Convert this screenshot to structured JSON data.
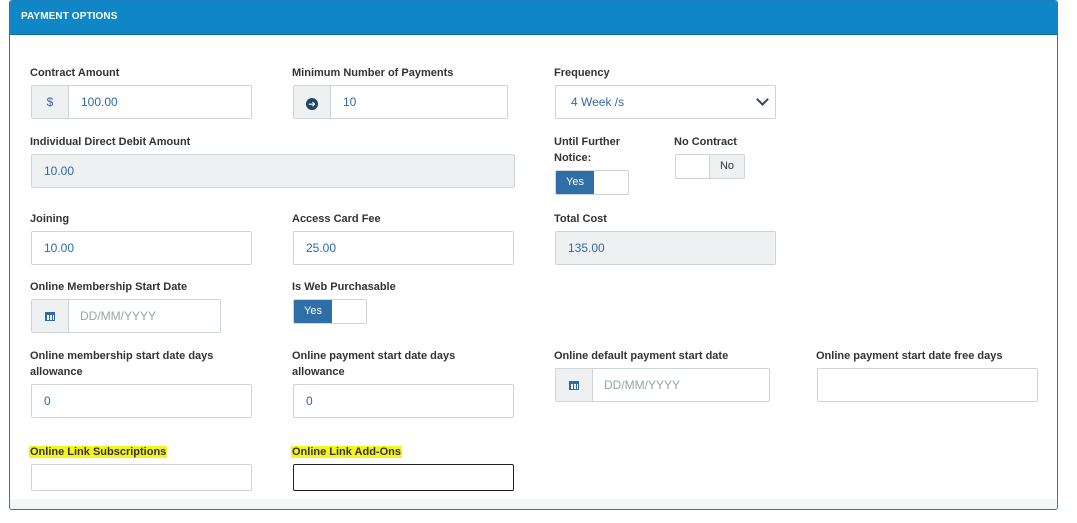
{
  "panel": {
    "title": "PAYMENT OPTIONS"
  },
  "fields": {
    "contract_amount": {
      "label": "Contract Amount",
      "prefix": "$",
      "value": "100.00"
    },
    "min_payments": {
      "label": "Minimum Number of Payments",
      "value": "10",
      "prefix_icon": "arrow-circle-right-icon"
    },
    "frequency": {
      "label": "Frequency",
      "selected": "4 Week /s"
    },
    "direct_debit": {
      "label": "Individual Direct Debit Amount",
      "value": "10.00"
    },
    "until_further_notice": {
      "label_line1": "Until Further",
      "label_line2": "Notice:",
      "on_label": "Yes"
    },
    "no_contract": {
      "label": "No Contract",
      "off_label": "No"
    },
    "joining": {
      "label": "Joining",
      "value": "10.00"
    },
    "access_card_fee": {
      "label": "Access Card Fee",
      "value": "25.00"
    },
    "total_cost": {
      "label": "Total Cost",
      "value": "135.00"
    },
    "online_start_date": {
      "label": "Online Membership Start Date",
      "placeholder": "DD/MM/YYYY",
      "icon": "calendar-icon"
    },
    "web_purchasable": {
      "label": "Is Web Purchasable",
      "on_label": "Yes"
    },
    "membership_days_allowance": {
      "label_line1": "Online membership start date days",
      "label_line2": "allowance",
      "value": "0"
    },
    "payment_days_allowance": {
      "label_line1": "Online payment start date days",
      "label_line2": "allowance",
      "value": "0"
    },
    "default_payment_start": {
      "label": "Online default payment start date",
      "placeholder": "DD/MM/YYYY",
      "icon": "calendar-icon"
    },
    "payment_free_days": {
      "label": "Online payment start date free days",
      "value": ""
    },
    "link_subscriptions": {
      "label": "Online Link Subscriptions",
      "value": ""
    },
    "link_addons": {
      "label": "Online Link Add-Ons",
      "value": ""
    }
  },
  "colors": {
    "header": "#0f87c6",
    "toggle_on": "#2f6ea7",
    "highlight": "#f6f21d",
    "value_text": "#2f6aa7"
  }
}
